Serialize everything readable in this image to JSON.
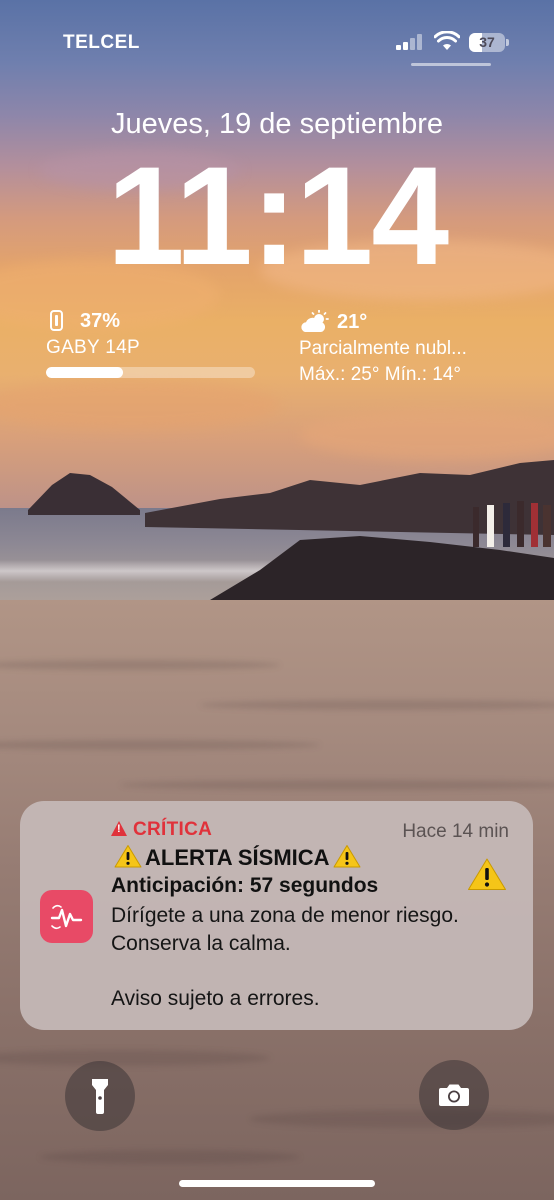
{
  "status_bar": {
    "carrier": "TELCEL",
    "battery_level": "37",
    "battery_fraction": 0.37,
    "icons": [
      "signal-icon",
      "wifi-icon",
      "battery-icon"
    ]
  },
  "lock": {
    "date": "Jueves, 19 de septiembre",
    "time": "11:14"
  },
  "widgets": {
    "battery": {
      "percent": "37%",
      "device": "GABY 14P",
      "level": 0.37,
      "icon": "iphone-icon"
    },
    "weather": {
      "icon": "partly-cloudy-icon",
      "temperature": "21°",
      "condition": "Parcialmente nubl...",
      "range": "Máx.: 25° Mín.: 14°"
    }
  },
  "notification": {
    "level": "CRÍTICA",
    "age": "Hace 14 min",
    "title": "ALERTA SÍSMICA",
    "subtitle": "Anticipación: 57 segundos",
    "body": "Dírígete a una zona de menor riesgo. Conserva la calma.",
    "footer": "Aviso sujeto a errores.",
    "app_icon": "seismic-alert-app-icon",
    "accent_color": "#e0323b",
    "warning_color": "#f5c518"
  },
  "buttons": {
    "left": "flashlight-icon",
    "right": "camera-icon"
  }
}
